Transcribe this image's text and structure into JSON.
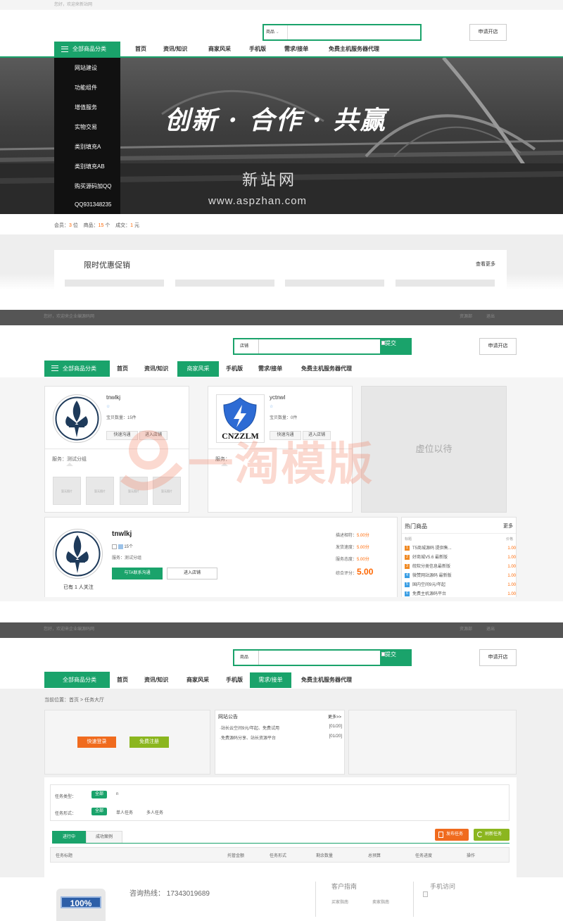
{
  "s1": {
    "welcome": "您好，欢迎来新站网",
    "search_type": "商品",
    "apply_button": "申请开店",
    "all_categories": "全部商品分类",
    "nav": [
      "首页",
      "资讯/知识",
      "商家风采",
      "手机版",
      "需求/接单",
      "免费主机服务器代理"
    ],
    "categories": [
      "网站建设",
      "功能组件",
      "增值服务",
      "实物交易",
      "类别填充A",
      "类别填充AB",
      "购买源码加QQ",
      "QQ931348235"
    ],
    "banner_title": "创新 · 合作 · 共赢",
    "banner_site": "新站网",
    "banner_url": "www.aspzhan.com",
    "stats": {
      "members_label": "会员：",
      "members": "3",
      "members_unit": "位",
      "goods_label": "商品：",
      "goods": "15",
      "goods_unit": "个",
      "deals_label": "成交：",
      "deals": "1",
      "deals_unit": "元"
    },
    "promo_title": "限时优惠促销",
    "promo_more": "查看更多"
  },
  "s2": {
    "welcome": "您好，欢迎来企业编源码网",
    "top_right": [
      "资源部",
      "退出"
    ],
    "search_type": "店铺",
    "submit": "提交",
    "apply_button": "申请开店",
    "all_categories": "全部商品分类",
    "nav": [
      "首页",
      "资讯/知识",
      "商家风采",
      "手机版",
      "需求/接单",
      "免费主机服务器代理"
    ],
    "active_nav": 2,
    "watermark": "一淘模版",
    "placeholder_box": "虚位以待",
    "shops": [
      {
        "name": "tnwlkj",
        "count": "宝贝数量：15件",
        "btn1": "快速沟通",
        "btn2": "进入店铺",
        "service": "服务：测试分组",
        "thumb": "暂无图片"
      },
      {
        "name": "yctnwl",
        "count": "宝贝数量：0件",
        "btn1": "快速沟通",
        "btn2": "进入店铺",
        "service": "服务：",
        "logo_text": "CNZZLM"
      }
    ],
    "featured": {
      "name": "tnwlkj",
      "count": "15个",
      "service": "服务：测试分组",
      "followers": "已有 1 人关注",
      "btn_contact": "与TA联系沟通",
      "btn_enter": "进入店铺",
      "ratings": [
        {
          "label": "描述相符：",
          "value": "5.00分"
        },
        {
          "label": "发货速度：",
          "value": "5.00分"
        },
        {
          "label": "服务态度：",
          "value": "5.00分"
        }
      ],
      "overall_label": "综合评分：",
      "overall": "5.00"
    },
    "hot": {
      "title": "热门商品",
      "more": "更多",
      "col1": "标题",
      "col2": "价格",
      "items": [
        {
          "n": "1",
          "title": "T5商城源码 提供售...",
          "price": "1.00"
        },
        {
          "n": "2",
          "title": "好商城V5.6 最新版",
          "price": "1.00"
        },
        {
          "n": "3",
          "title": "皖软分类信息最新版",
          "price": "1.00"
        },
        {
          "n": "4",
          "title": "微赞网站源码 最新版",
          "price": "1.00"
        },
        {
          "n": "5",
          "title": "国内空间9元/年起",
          "price": "1.00"
        },
        {
          "n": "6",
          "title": "免费主机源码平台",
          "price": "1.00"
        }
      ],
      "colors": [
        "#f08a24",
        "#f08a24",
        "#f08a24",
        "#3a9ee4",
        "#3a9ee4",
        "#3a9ee4"
      ]
    }
  },
  "s3": {
    "welcome": "您好，欢迎来企业编源码网",
    "top_right": [
      "资源部",
      "退出"
    ],
    "search_type": "商品",
    "submit": "提交",
    "apply_button": "申请开店",
    "all_categories": "全部商品分类",
    "nav": [
      "首页",
      "资讯/知识",
      "商家风采",
      "手机版",
      "需求/接单",
      "免费主机服务器代理"
    ],
    "active_nav": 4,
    "breadcrumb": "当前位置：首页 > 任务大厅",
    "login": "快速登录",
    "register": "免费注册",
    "notice_title": "网站公告",
    "notice_more": "更多>>",
    "notices": [
      {
        "text": "·站长云空间9元/年起、免费试用",
        "date": "[01/20]"
      },
      {
        "text": "·免费源码分享、站长资源平台",
        "date": "[01/20]"
      }
    ],
    "task_type_label": "任务类型：",
    "task_types": [
      "全部",
      "n"
    ],
    "task_form_label": "任务形式：",
    "task_forms": [
      "全部",
      "单人任务",
      "多人任务"
    ],
    "tabs": [
      "进行中",
      "成功案例"
    ],
    "publish": "发布任务",
    "refresh": "刷新任务",
    "columns": [
      "任务标题",
      "托管金额",
      "任务形式",
      "剩余数量",
      "总预算",
      "任务进度",
      "操作"
    ],
    "hotline_label": "咨询热线：",
    "hotline": "17343019689",
    "badge": "100%",
    "guide_title": "客户指南",
    "guide_links": [
      "买家指南",
      "卖家指南"
    ],
    "mobile_title": "手机访问"
  }
}
